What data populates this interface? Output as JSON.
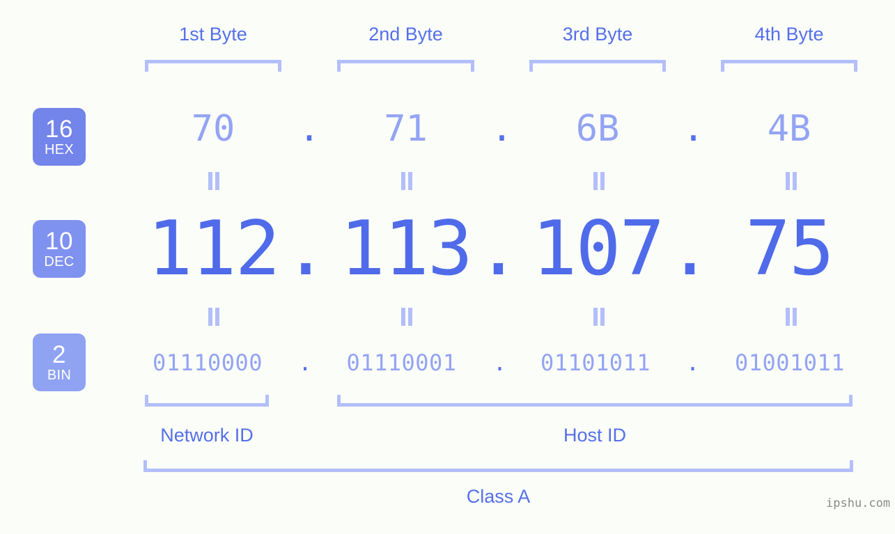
{
  "meta": {
    "background_color": "#fbfdf8",
    "accent_color": "#4f6bea",
    "accent_light_color": "#93a4f4",
    "bracket_color": "#b3bffa",
    "badge_text_color": "#ffffff"
  },
  "byte_headers": [
    {
      "label": "1st Byte"
    },
    {
      "label": "2nd Byte"
    },
    {
      "label": "3rd Byte"
    },
    {
      "label": "4th Byte"
    }
  ],
  "rows": {
    "hex": {
      "badge": {
        "base": "16",
        "system": "HEX",
        "color": "#7384ea"
      },
      "values": [
        "70",
        "71",
        "6B",
        "4B"
      ],
      "separator": "."
    },
    "dec": {
      "badge": {
        "base": "10",
        "system": "DEC",
        "color": "#8092ef"
      },
      "values": [
        "112",
        "113",
        "107",
        "75"
      ],
      "separator": "."
    },
    "bin": {
      "badge": {
        "base": "2",
        "system": "BIN",
        "color": "#8fa3f2"
      },
      "values": [
        "01110000",
        "01110001",
        "01101011",
        "01001011"
      ],
      "separator": "."
    }
  },
  "equality_marks": {
    "symbol": "=",
    "count_per_row": 4
  },
  "sections": [
    {
      "label": "Network ID"
    },
    {
      "label": "Host ID"
    }
  ],
  "class_label": "Class A",
  "watermark": "ipshu.com"
}
